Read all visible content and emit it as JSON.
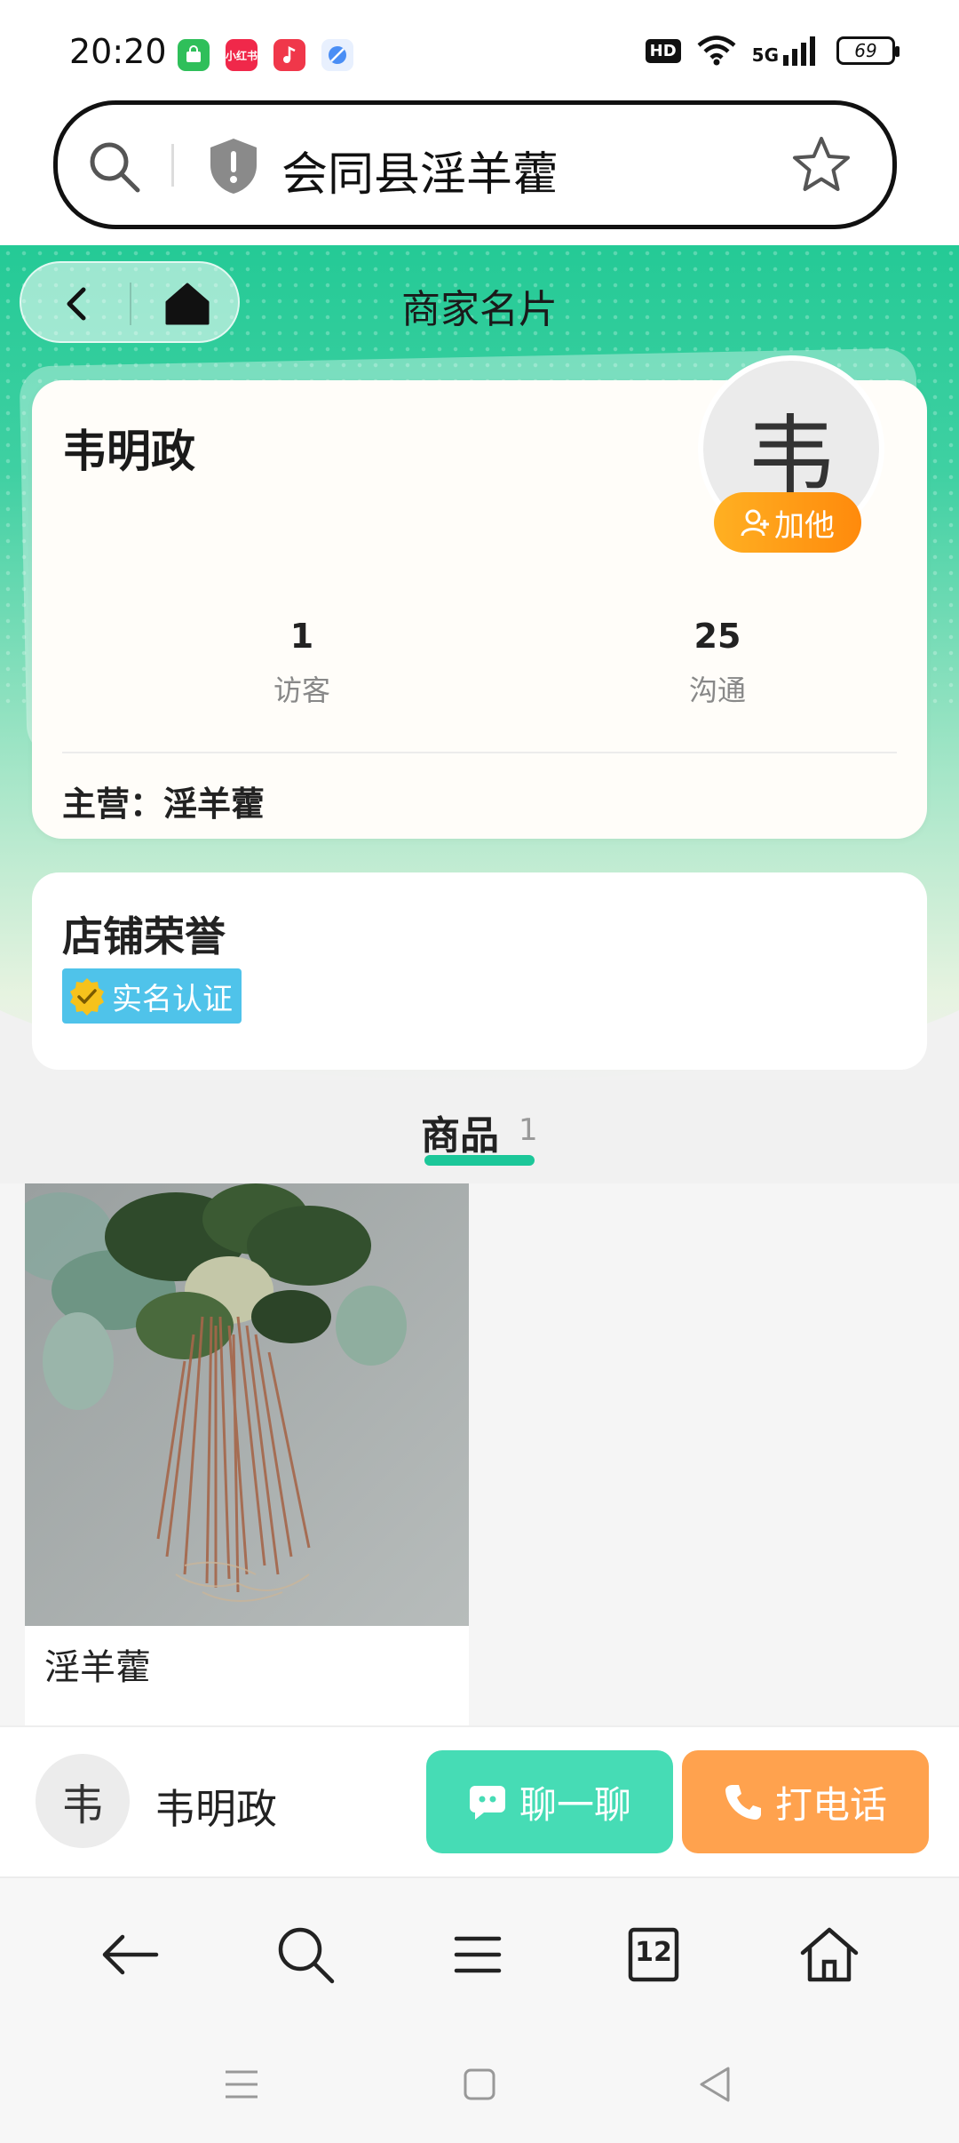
{
  "status_bar": {
    "time": "20:20",
    "apps": [
      {
        "name": "app-store-icon",
        "label": "",
        "color": "#2fbf5a"
      },
      {
        "name": "xiaohongshu-icon",
        "label": "小红书",
        "color": "#f0284a"
      },
      {
        "name": "music-icon",
        "label": "",
        "color": "#f0374a"
      },
      {
        "name": "browser-icon",
        "label": "",
        "color": "#4a8ef5"
      }
    ],
    "hd": "HD",
    "network": "5G",
    "battery": "69"
  },
  "url_bar": {
    "text": "会同县淫羊藿"
  },
  "header": {
    "title": "商家名片"
  },
  "profile": {
    "name": "韦明政",
    "avatar_char": "韦",
    "follow_label": "加他",
    "stats": [
      {
        "value": "1",
        "label": "访客"
      },
      {
        "value": "25",
        "label": "沟通"
      }
    ],
    "main_business": "主营：淫羊藿"
  },
  "honors": {
    "title": "店铺荣誉",
    "badge": "实名认证"
  },
  "products_tab": {
    "label": "商品",
    "count": "1"
  },
  "products": [
    {
      "name": "淫羊藿"
    }
  ],
  "action_bar": {
    "avatar_char": "韦",
    "name": "韦明政",
    "chat_label": "聊一聊",
    "call_label": "打电话"
  },
  "browser_toolbar": {
    "tab_count": "12"
  },
  "colors": {
    "brand_green": "#20c994",
    "chat_button": "#46dcb5",
    "call_button": "#ffa24e",
    "follow_button": "#ff8a0c",
    "verify_badge": "#4fc3ea"
  }
}
